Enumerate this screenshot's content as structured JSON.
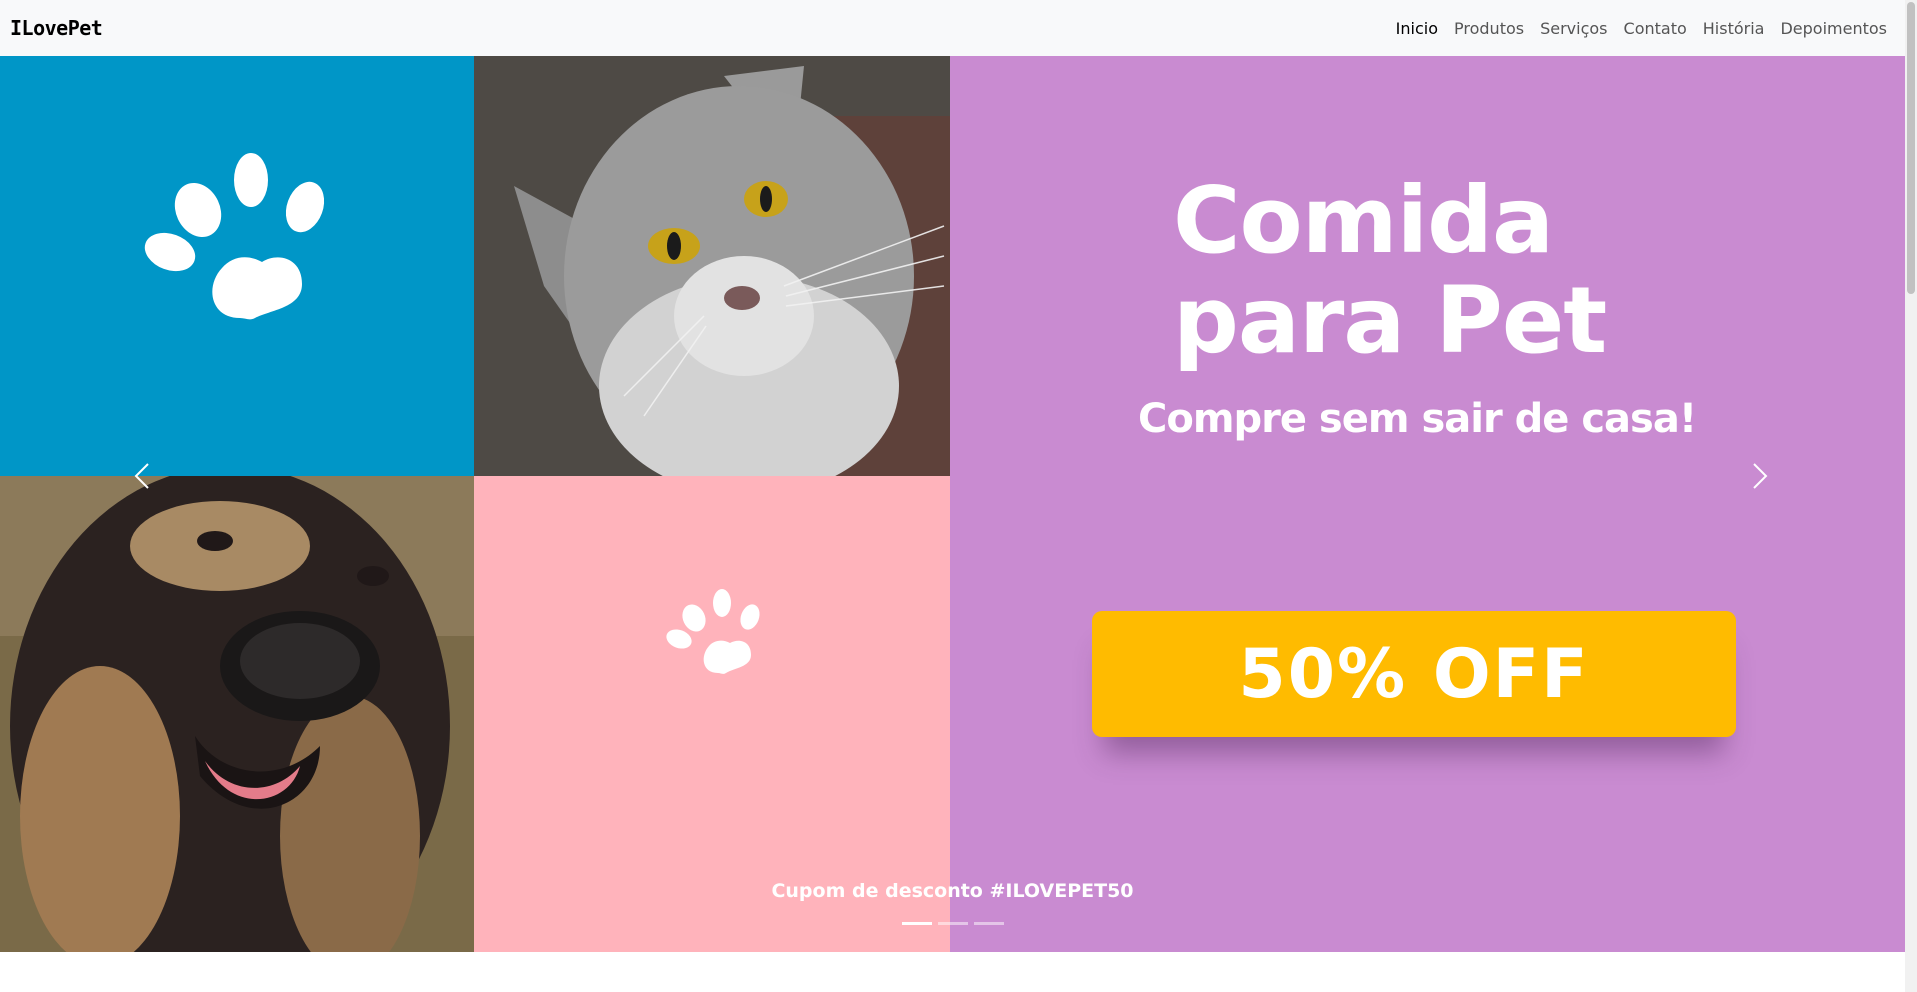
{
  "brand": "ILovePet",
  "nav": {
    "items": [
      "Inicio",
      "Produtos",
      "Serviços",
      "Contato",
      "História",
      "Depoimentos"
    ]
  },
  "banner": {
    "headline_line1": "Comida",
    "headline_line2": "para Pet",
    "subheadline": "Compre sem sair de casa!",
    "offer": "50% OFF",
    "caption": "Cupom de desconto #ILOVEPET50"
  },
  "carousel": {
    "slides": 3,
    "active_slide": 1
  },
  "colors": {
    "blue": "#0096c7",
    "pink": "#ffb3bb",
    "purple": "#c98bd1",
    "offer": "#ffbb00",
    "navbar": "#f8f9fa"
  }
}
